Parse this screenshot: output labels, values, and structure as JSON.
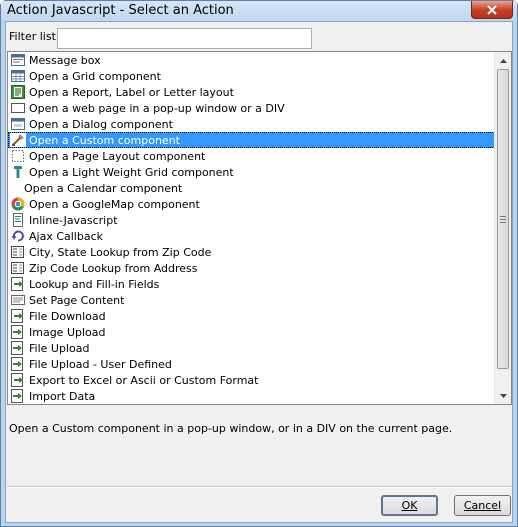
{
  "window": {
    "title": "Action Javascript - Select an Action"
  },
  "filter": {
    "label": "Filter list:",
    "value": "",
    "placeholder": ""
  },
  "list": {
    "items": [
      {
        "label": "Message box",
        "icon": "message-box-icon"
      },
      {
        "label": "Open a Grid component",
        "icon": "grid-icon"
      },
      {
        "label": "Open a Report, Label or Letter layout",
        "icon": "report-icon"
      },
      {
        "label": "Open a web page in a pop-up window or a DIV",
        "icon": "web-page-icon"
      },
      {
        "label": "Open a Dialog component",
        "icon": "dialog-icon"
      },
      {
        "label": "Open a Custom component",
        "icon": "custom-component-icon",
        "selected": true
      },
      {
        "label": "Open a Page Layout component",
        "icon": "page-layout-icon"
      },
      {
        "label": "Open a Light Weight Grid component",
        "icon": "light-grid-icon"
      },
      {
        "label": "Open a Calendar component",
        "icon": "none"
      },
      {
        "label": "Open a GoogleMap component",
        "icon": "google-map-icon"
      },
      {
        "label": "Inline-Javascript",
        "icon": "javascript-icon"
      },
      {
        "label": "Ajax Callback",
        "icon": "ajax-callback-icon"
      },
      {
        "label": "City, State Lookup from Zip Code",
        "icon": "zip-lookup-icon"
      },
      {
        "label": "Zip Code Lookup from Address",
        "icon": "address-lookup-icon"
      },
      {
        "label": "Lookup and Fill-in Fields",
        "icon": "lookup-fill-icon"
      },
      {
        "label": "Set Page Content",
        "icon": "page-content-icon"
      },
      {
        "label": "File Download",
        "icon": "file-download-icon"
      },
      {
        "label": "Image Upload",
        "icon": "upload-icon"
      },
      {
        "label": "File Upload",
        "icon": "upload-icon"
      },
      {
        "label": "File Upload - User Defined",
        "icon": "upload-icon"
      },
      {
        "label": "Export to Excel or Ascii or Custom Format",
        "icon": "export-icon"
      },
      {
        "label": "Import Data",
        "icon": "import-icon"
      }
    ]
  },
  "description": {
    "text": "Open a Custom component in a pop-up window, or in a DIV on the current page."
  },
  "buttons": {
    "ok_label": "OK",
    "cancel_label": "Cancel"
  },
  "colors": {
    "selection": "#3399ff",
    "titlebar": "#c0d6ee",
    "close_button": "#c7432a"
  }
}
